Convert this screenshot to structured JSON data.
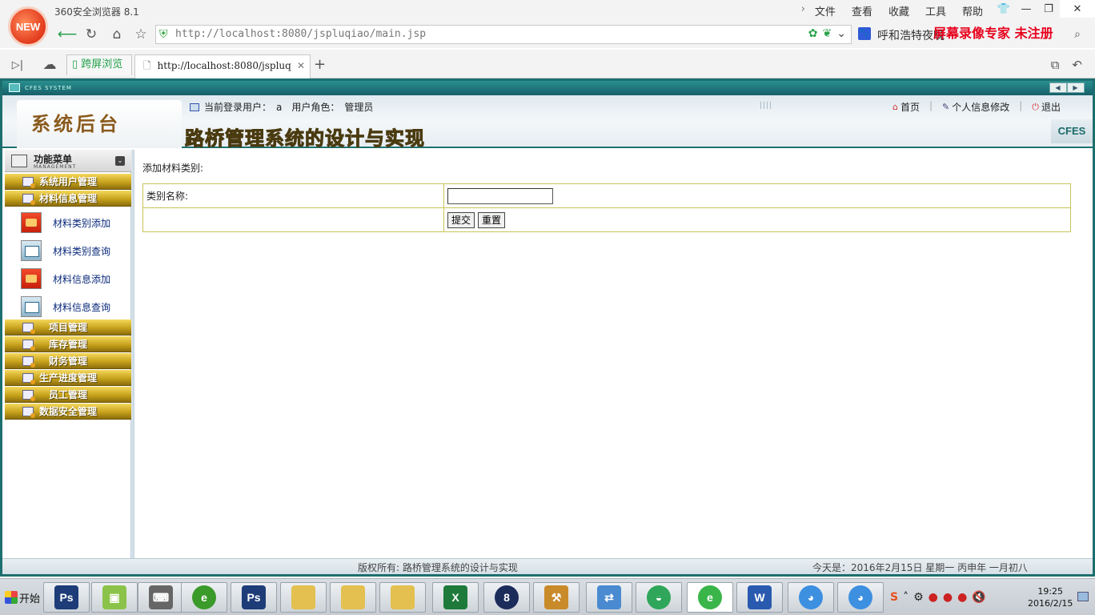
{
  "browser": {
    "logo_text": "NEW",
    "title": "360安全浏览器 8.1",
    "menu": [
      "文件",
      "查看",
      "收藏",
      "工具",
      "帮助"
    ],
    "url": "http://localhost:8080/jspluqiao/main.jsp",
    "search_text": "呼和浩特夜晚",
    "watermark": "屏幕录像专家  未注册",
    "tabs": {
      "cross_screen": "跨屏浏览",
      "active": "http://localhost:8080/jspluq"
    }
  },
  "app": {
    "titlebar_text": "CFES SYSTEM",
    "system_title": "系统后台",
    "project_title": "路桥管理系统的设计与实现",
    "badge": "CFES",
    "login": {
      "user_label": "当前登录用户：",
      "user_value": "a",
      "role_label": "用户角色：",
      "role_value": "管理员"
    },
    "links": {
      "home": "首页",
      "profile": "个人信息修改",
      "logout": "退出"
    }
  },
  "sidebar": {
    "title": "功能菜单",
    "subtitle": "MANAGEMENT",
    "categories": [
      "系统用户管理",
      "材料信息管理",
      "项目管理",
      "库存管理",
      "财务管理",
      "生产进度管理",
      "员工管理",
      "数据安全管理"
    ],
    "sub_items": [
      "材料类别添加",
      "材料类别查询",
      "材料信息添加",
      "材料信息查询"
    ]
  },
  "content": {
    "title": "添加材料类别:",
    "field_label": "类别名称:",
    "field_value": "",
    "submit": "提交",
    "reset": "重置"
  },
  "footer": {
    "copyright": "版权所有: 路桥管理系统的设计与实现",
    "today": "今天是：2016年2月15日  星期一  丙申年  一月初八"
  },
  "taskbar": {
    "start": "开始",
    "time": "19:25",
    "date": "2016/2/15"
  }
}
